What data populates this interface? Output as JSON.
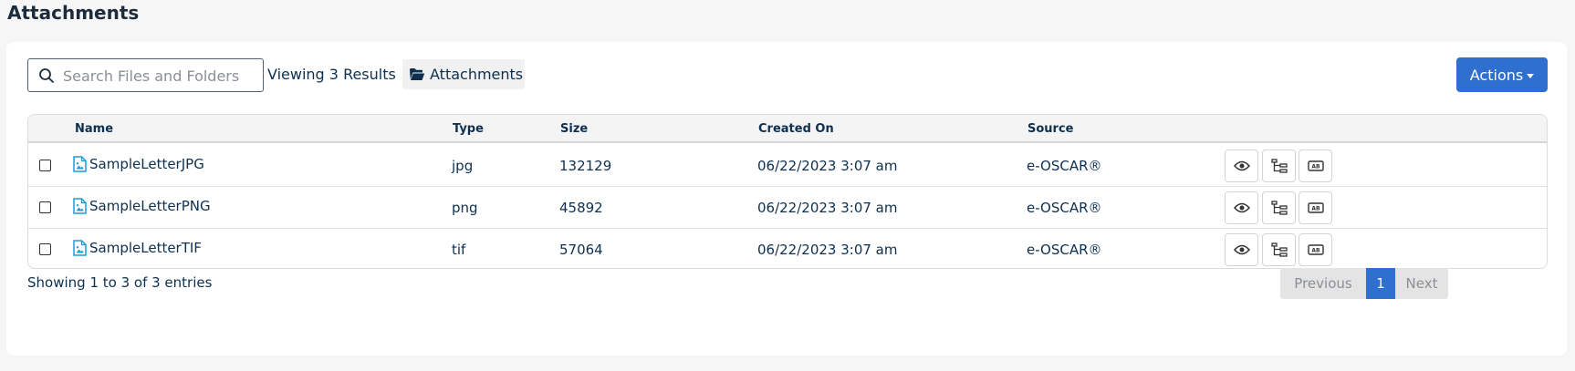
{
  "page": {
    "title": "Attachments"
  },
  "toolbar": {
    "search_placeholder": "Search Files and Folders",
    "search_value": "",
    "results_text": "Viewing 3 Results",
    "folder_label": "Attachments",
    "actions_label": "Actions"
  },
  "table": {
    "columns": [
      "Name",
      "Type",
      "Size",
      "Created On",
      "Source"
    ],
    "rows": [
      {
        "name": "SampleLetterJPG",
        "type": "jpg",
        "size": "132129",
        "created": "06/22/2023 3:07 am",
        "source": "e-OSCAR®"
      },
      {
        "name": "SampleLetterPNG",
        "type": "png",
        "size": "45892",
        "created": "06/22/2023 3:07 am",
        "source": "e-OSCAR®"
      },
      {
        "name": "SampleLetterTIF",
        "type": "tif",
        "size": "57064",
        "created": "06/22/2023 3:07 am",
        "source": "e-OSCAR®"
      }
    ],
    "row_actions": [
      "eye-icon",
      "hierarchy-icon",
      "text-recognition-icon"
    ]
  },
  "footer": {
    "entries_text": "Showing 1 to 3 of 3 entries",
    "pagination": {
      "previous": "Previous",
      "current": "1",
      "next": "Next"
    }
  },
  "colors": {
    "primary": "#2f6fd0",
    "text": "#0d3050",
    "file_icon": "#1d9bd6"
  }
}
